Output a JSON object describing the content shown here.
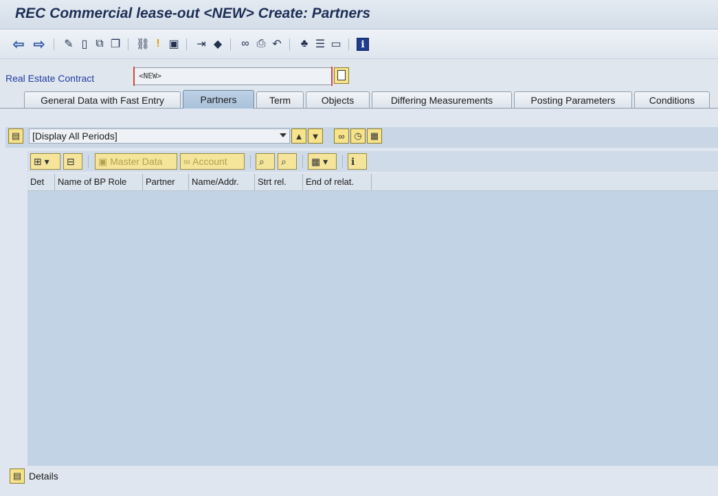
{
  "window": {
    "title": "REC Commercial lease-out <NEW> Create: Partners"
  },
  "toolbar": {
    "icons": [
      "back-arrow-icon",
      "forward-arrow-icon",
      "edit-wand-icon",
      "new-document-icon",
      "copy-icon",
      "duplicate-icon",
      "link-icon",
      "warning-icon",
      "save-icon",
      "transfer-icon",
      "eraser-icon",
      "glasses-icon",
      "print-icon",
      "history-icon",
      "hierarchy-icon",
      "list-icon",
      "display-icon",
      "info-icon"
    ],
    "info_glyph": "i"
  },
  "header": {
    "label": "Real Estate Contract",
    "value": "<NEW>"
  },
  "tabs": [
    {
      "label": "General Data with Fast Entry",
      "active": false
    },
    {
      "label": "Partners",
      "active": true
    },
    {
      "label": "Term",
      "active": false
    },
    {
      "label": "Objects",
      "active": false
    },
    {
      "label": "Differing Measurements",
      "active": false
    },
    {
      "label": "Posting Parameters",
      "active": false
    },
    {
      "label": "Conditions",
      "active": false
    }
  ],
  "period": {
    "selected": "[Display All Periods]"
  },
  "grid_toolbar": {
    "master_data_label": "Master Data",
    "account_label": "Account"
  },
  "columns": [
    "Det",
    "Name of BP Role",
    "Partner",
    "Name/Addr.",
    "Strt rel.",
    "End of relat."
  ],
  "footer": {
    "details_label": "Details"
  },
  "colors": {
    "title": "#1e2f55",
    "label_blue": "#1f3ba0",
    "active_tab": "#a9c1da",
    "grid_body": "#c2d3e5",
    "button_yellow": "#f4e59b"
  }
}
